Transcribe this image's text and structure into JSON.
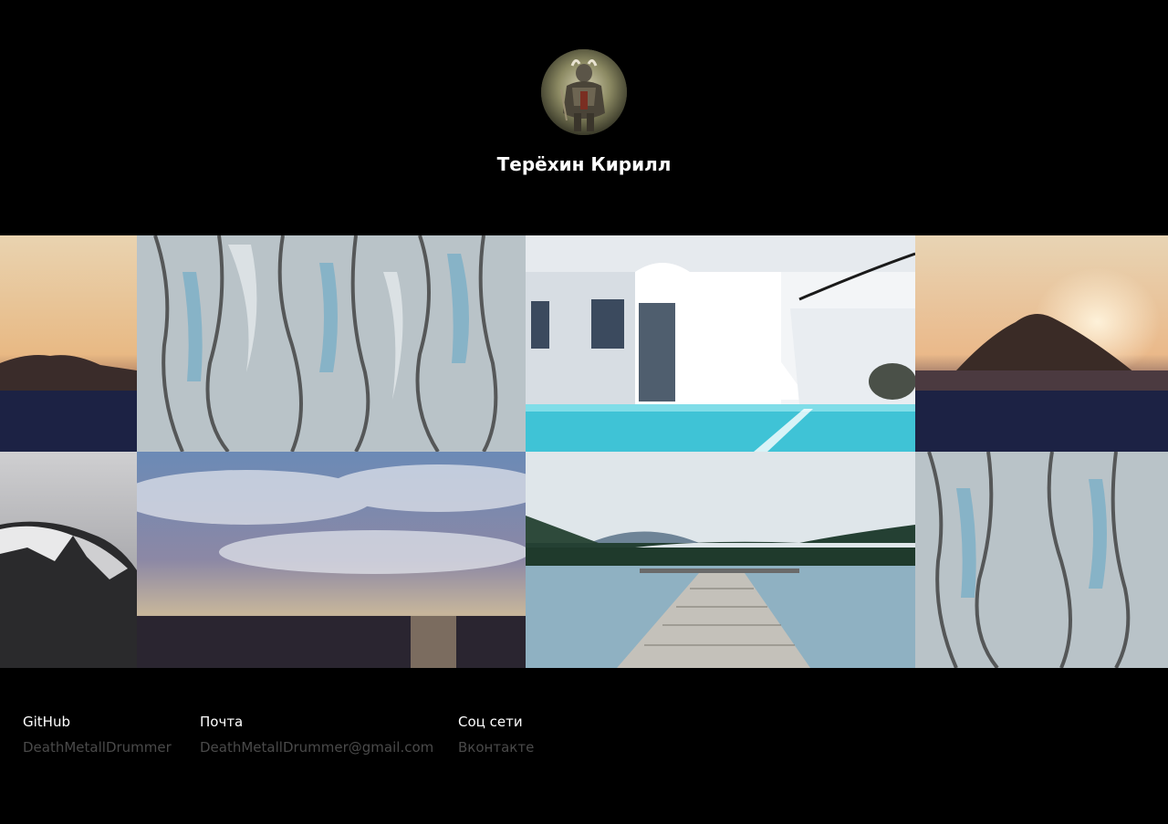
{
  "profile": {
    "name": "Терёхин Кирилл",
    "avatar_icon": "avatar-icon"
  },
  "gallery": {
    "images": [
      {
        "label": "sunset-rock-left-crop"
      },
      {
        "label": "glacier"
      },
      {
        "label": "white-house-pool"
      },
      {
        "label": "sunset-rock"
      },
      {
        "label": "snowy-mountain-left-crop"
      },
      {
        "label": "cloudy-sky-sea"
      },
      {
        "label": "lake-pier"
      },
      {
        "label": "glacier-right-crop"
      }
    ]
  },
  "footer": {
    "columns": [
      {
        "title": "GitHub",
        "link": "DeathMetallDrummer"
      },
      {
        "title": "Почта",
        "link": "DeathMetallDrummer@gmail.com"
      },
      {
        "title": "Соц сети",
        "link": "Вконтакте"
      }
    ]
  },
  "colors": {
    "background": "#000000",
    "title": "#ffffff",
    "link": "#4a4a4a"
  }
}
